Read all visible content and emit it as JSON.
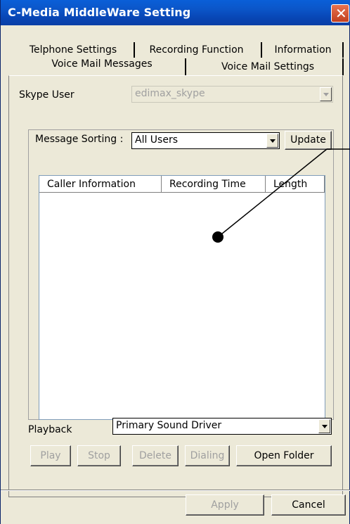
{
  "window": {
    "title": "C-Media MiddleWare Setting"
  },
  "tabs": {
    "row1": [
      "Telphone Settings",
      "Recording Function",
      "Information"
    ],
    "row2": [
      "Voice Mail Messages",
      "Voice Mail Settings"
    ],
    "active": "Voice Mail Messages"
  },
  "skype_user": {
    "label": "Skype User",
    "value": "edimax_skype"
  },
  "message_sorting": {
    "label": "Message Sorting :",
    "value": "All Users"
  },
  "buttons": {
    "update": "Update",
    "play": "Play",
    "stop": "Stop",
    "delete": "Delete",
    "dialing": "Dialing",
    "open_folder": "Open Folder",
    "apply": "Apply",
    "cancel": "Cancel"
  },
  "messages_table": {
    "columns": [
      "Caller Information",
      "Recording Time",
      "Length"
    ],
    "rows": []
  },
  "playback": {
    "label": "Playback",
    "value": "Primary Sound Driver"
  }
}
